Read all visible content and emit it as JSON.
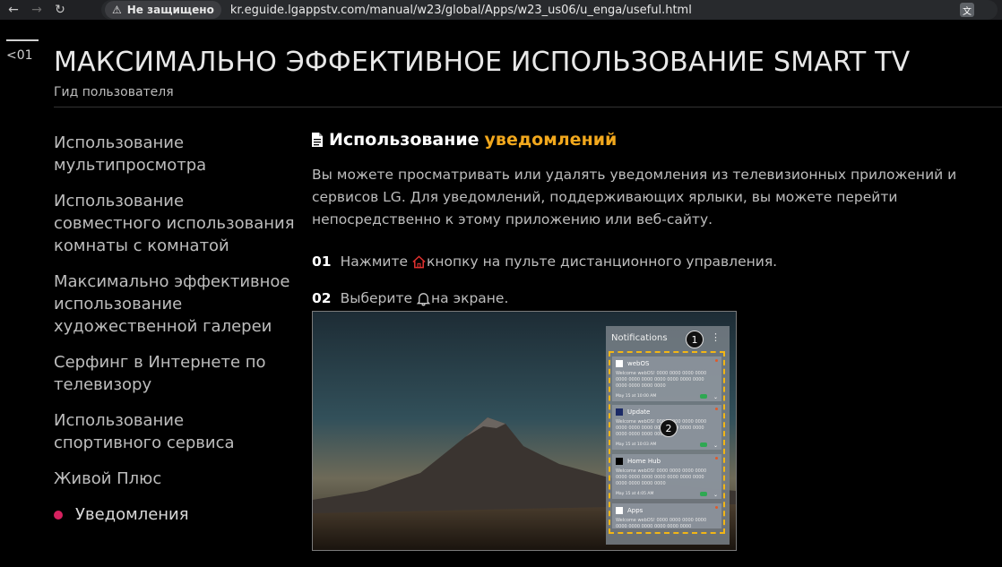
{
  "browser": {
    "security_label": "Не защищено",
    "url": "kr.eguide.lgappstv.com/manual/w23/global/Apps/w23_us06/u_enga/useful.html"
  },
  "header": {
    "back_label": "<01",
    "title": "МАКСИМАЛЬНО ЭФФЕКТИВНОЕ ИСПОЛЬЗОВАНИЕ SMART TV",
    "subtitle": "Гид пользователя"
  },
  "sidebar": {
    "items": [
      {
        "label": "Использование мультипросмотра"
      },
      {
        "label": "Использование совместного использования комнаты с комнатой"
      },
      {
        "label": "Максимально эффективное использование художественной галереи"
      },
      {
        "label": "Серфинг в Интернете по телевизору"
      },
      {
        "label": "Использование спортивного сервиса"
      },
      {
        "label": "Живой Плюс"
      },
      {
        "label": "Уведомления"
      }
    ]
  },
  "main": {
    "title_prefix": "Использование",
    "title_accent": "уведомлений",
    "intro": "Вы можете просматривать или удалять уведомления из телевизионных приложений и сервисов LG. Для уведомлений, поддерживающих ярлыки, вы можете перейти непосредственно к этому приложению или веб-сайту.",
    "steps": [
      {
        "num": "01",
        "before": "Нажмите",
        "after": "кнопку на пульте дистанционного управления."
      },
      {
        "num": "02",
        "before": "Выберите",
        "after": "на экране."
      }
    ]
  },
  "figure": {
    "panel_title": "Notifications",
    "markers": [
      "1",
      "2"
    ],
    "cards": [
      {
        "name": "webOS",
        "text": "Welcome webOS! 0000 0000 0000 0000 0000 0000 0000 0000 0000 0000 0000 0000 0000 0000 0000",
        "date": "May 15 at 10:00 AM"
      },
      {
        "name": "Update",
        "text": "Welcome webOS! 0000 0000 0000 0000 0000 0000 0000 0000 0000 0000 0000 0000 0000 0000 0000",
        "date": "May 15 at 10:03 AM"
      },
      {
        "name": "Home Hub",
        "text": "Welcome webOS! 0000 0000 0000 0000 0000 0000 0000 0000 0000 0000 0000 0000 0000 0000 0000",
        "date": "May 15 at 4:05 AM"
      },
      {
        "name": "Apps",
        "text": "Welcome webOS! 0000 0000 0000 0000 0000 0000 0000 0000 0000 0000",
        "date": ""
      }
    ]
  }
}
